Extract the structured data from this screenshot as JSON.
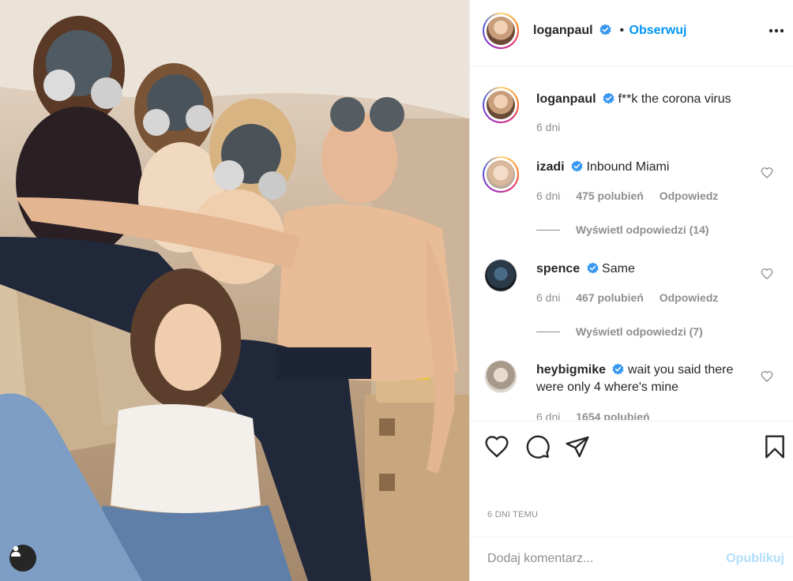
{
  "post": {
    "author": "loganpaul",
    "follow_label": "Obserwuj",
    "separator": "•",
    "caption": "f**k the corona virus",
    "caption_age": "6 dni",
    "timestamp": "6 DNI TEMU"
  },
  "comments": [
    {
      "username": "izadi",
      "text": "Inbound Miami",
      "age": "6 dni",
      "likes": "475 polubień",
      "reply_label": "Odpowiedz",
      "view_replies": "Wyświetl odpowiedzi (14)"
    },
    {
      "username": "spence",
      "text": "Same",
      "age": "6 dni",
      "likes": "467 polubień",
      "reply_label": "Odpowiedz",
      "view_replies": "Wyświetl odpowiedzi (7)"
    },
    {
      "username": "heybigmike",
      "text_line1": "wait you said there",
      "text_line2": "were only 4 where's mine",
      "age": "6 dni",
      "likes": "1654 polubień"
    }
  ],
  "composer": {
    "placeholder": "Dodaj komentarz...",
    "publish_label": "Opublikuj"
  },
  "icons": [
    "heart-icon",
    "comment-icon",
    "share-icon",
    "bookmark-icon",
    "more-icon",
    "verified-icon",
    "user-tag-icon"
  ],
  "colors": {
    "accent": "#0095f6",
    "publish_disabled": "#b2dffc",
    "muted": "#8e8e8e",
    "border": "#efefef"
  }
}
